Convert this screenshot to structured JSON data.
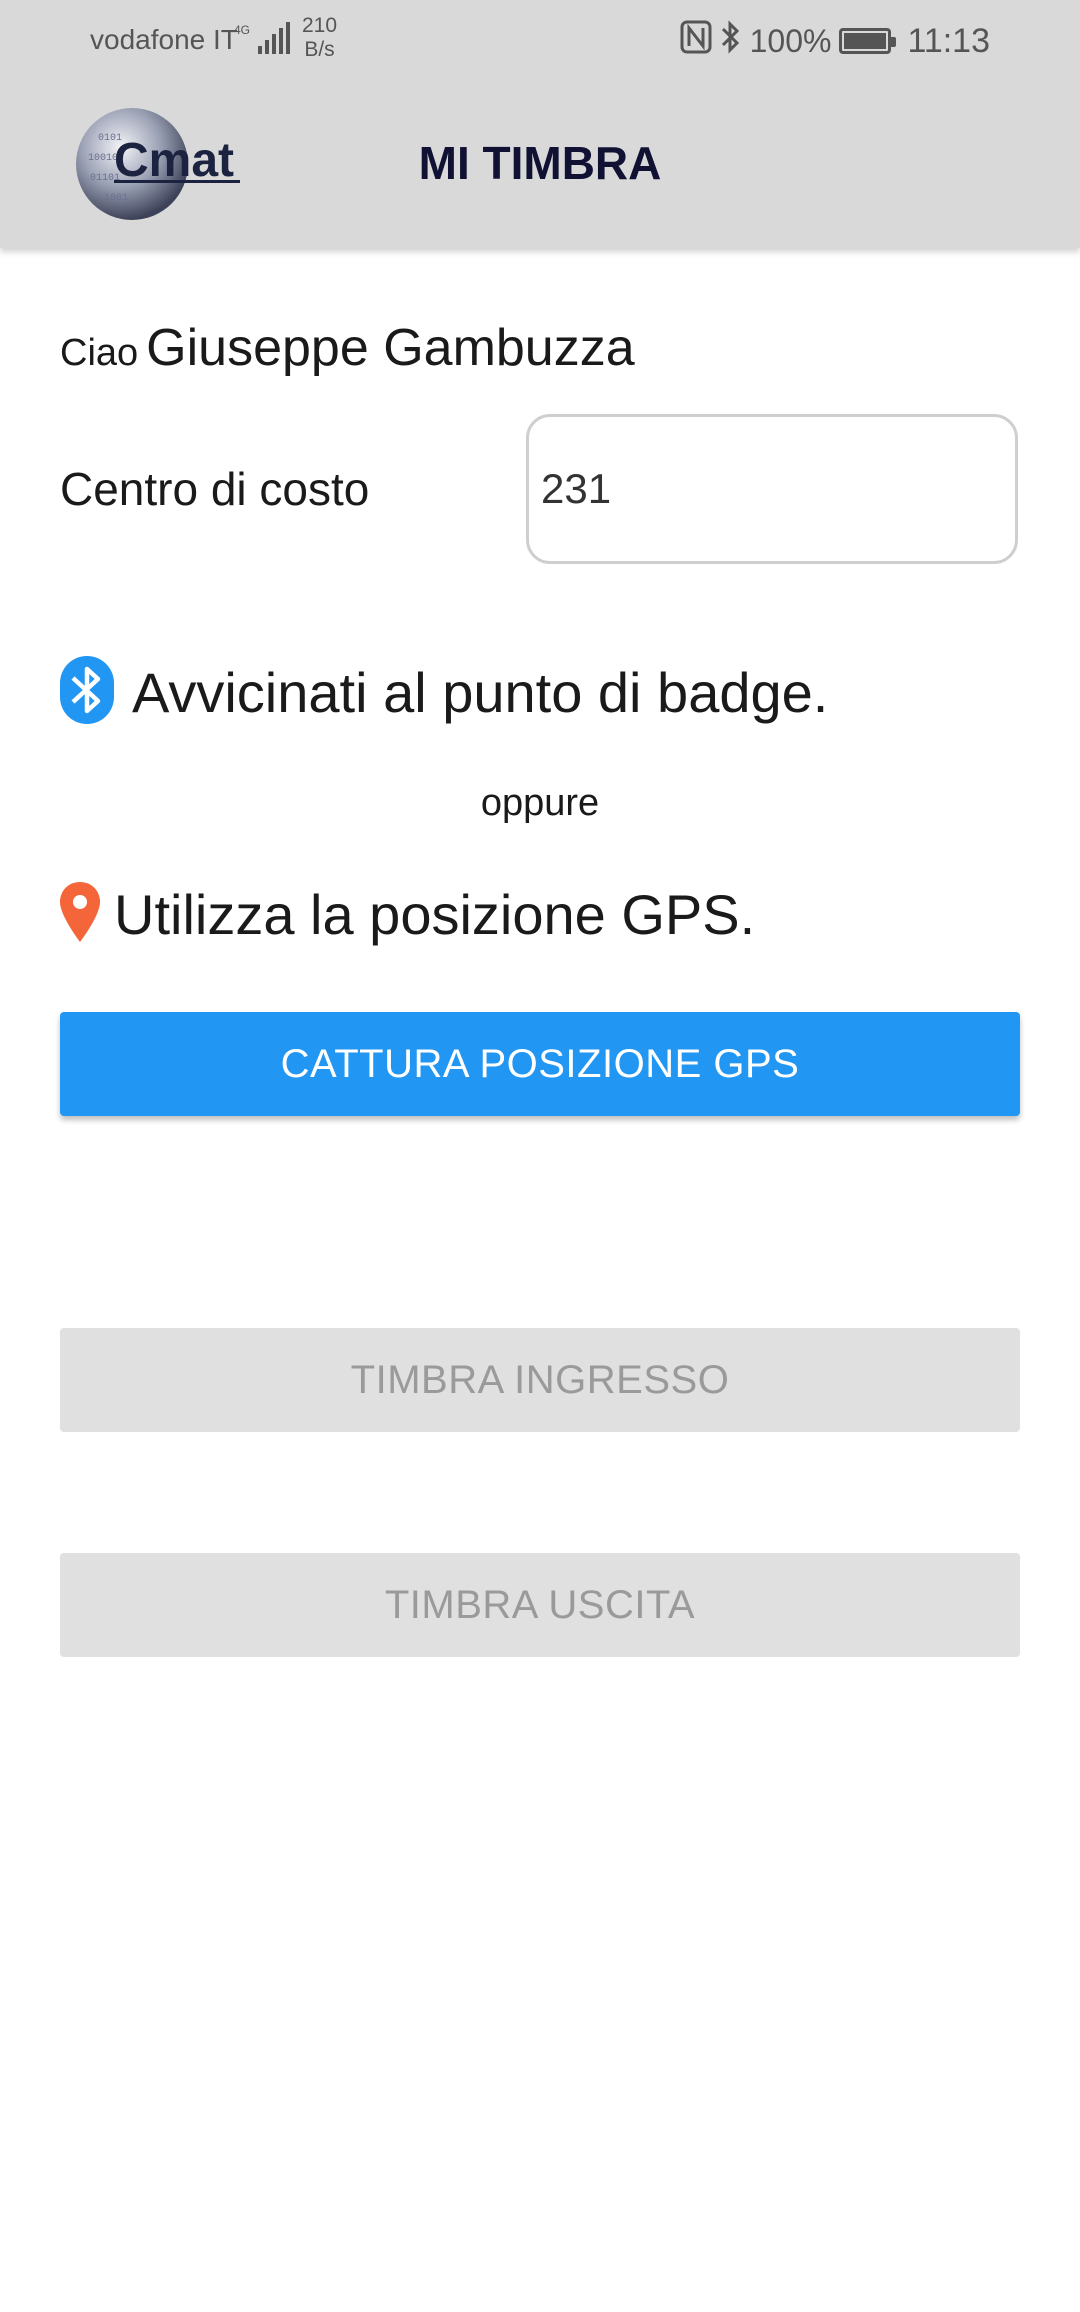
{
  "status_bar": {
    "carrier": "vodafone IT",
    "network": "4G",
    "net_speed_value": "210",
    "net_speed_unit": "B/s",
    "battery": "100%",
    "time": "11:13"
  },
  "app_bar": {
    "logo_text": "Cmat",
    "title": "MI TIMBRA"
  },
  "greeting": {
    "prefix": "Ciao",
    "name": "Giuseppe Gambuzza"
  },
  "cost_center": {
    "label": "Centro di costo",
    "value": "231"
  },
  "bluetooth_hint": "Avvicinati al punto di badge.",
  "or_label": "oppure",
  "gps_hint": "Utilizza la posizione GPS.",
  "buttons": {
    "capture_gps": "CATTURA POSIZIONE GPS",
    "check_in": "TIMBRA INGRESSO",
    "check_out": "TIMBRA USCITA"
  },
  "colors": {
    "primary": "#2196f3",
    "bluetooth_icon": "#2196f3",
    "gps_pin": "#f4663a",
    "disabled_bg": "#e0e0e0",
    "disabled_text": "#9a9a9a"
  },
  "battery_level": 1.0
}
